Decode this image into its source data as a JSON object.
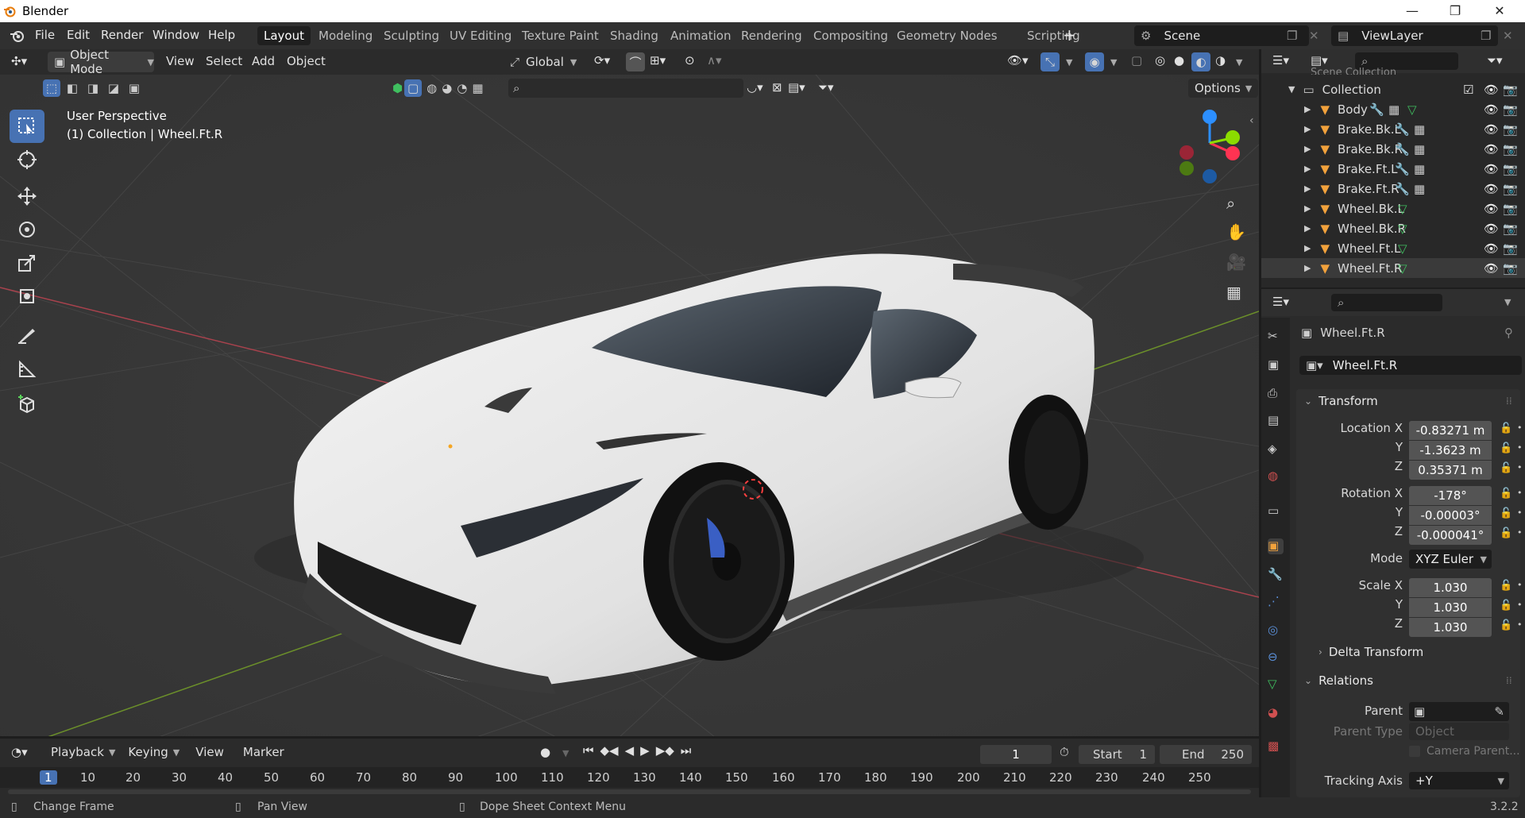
{
  "window": {
    "title": "Blender",
    "minimize": "—",
    "maximize": "❐",
    "close": "✕"
  },
  "menu": [
    "File",
    "Edit",
    "Render",
    "Window",
    "Help"
  ],
  "workspaces": [
    "Layout",
    "Modeling",
    "Sculpting",
    "UV Editing",
    "Texture Paint",
    "Shading",
    "Animation",
    "Rendering",
    "Compositing",
    "Geometry Nodes",
    "Scripting"
  ],
  "workspace_add": "+",
  "scene": "Scene",
  "view_layer": "ViewLayer",
  "viewport": {
    "mode": "Object Mode",
    "menus": [
      "View",
      "Select",
      "Add",
      "Object"
    ],
    "orientation": "Global",
    "options": "Options",
    "perspective": "User Perspective",
    "context": "(1) Collection | Wheel.Ft.R",
    "gizmo": {
      "x": "X",
      "y": "Y",
      "z": "Z"
    }
  },
  "outliner": {
    "root": "Scene Collection",
    "collection": "Collection",
    "items": [
      "Body",
      "Brake.Bk.L",
      "Brake.Bk.R",
      "Brake.Ft.L",
      "Brake.Ft.R",
      "Wheel.Bk.L",
      "Wheel.Bk.R",
      "Wheel.Ft.L",
      "Wheel.Ft.R"
    ],
    "selected": "Wheel.Ft.R"
  },
  "properties": {
    "object_name": "Wheel.Ft.R",
    "object_field": "Wheel.Ft.R",
    "transform_title": "Transform",
    "location_label": "Location X",
    "location": [
      "-0.83271 m",
      "-1.3623 m",
      "0.35371 m"
    ],
    "rotation_label": "Rotation X",
    "rotation": [
      "-178°",
      "-0.00003°",
      "-0.000041°"
    ],
    "axis_y": "Y",
    "axis_z": "Z",
    "mode_label": "Mode",
    "mode_value": "XYZ Euler",
    "scale_label": "Scale X",
    "scale": [
      "1.030",
      "1.030",
      "1.030"
    ],
    "delta_transform": "Delta Transform",
    "relations_title": "Relations",
    "parent_label": "Parent",
    "parent_type_label": "Parent Type",
    "parent_type_value": "Object",
    "camera_parent": "Camera Parent...",
    "tracking_axis_label": "Tracking Axis",
    "tracking_axis_value": "+Y"
  },
  "timeline": {
    "menus": [
      "Playback",
      "Keying",
      "View",
      "Marker"
    ],
    "current_frame": "1",
    "start_label": "Start",
    "start": "1",
    "end_label": "End",
    "end": "250",
    "ticks": [
      "1",
      "10",
      "20",
      "30",
      "40",
      "50",
      "60",
      "70",
      "80",
      "90",
      "100",
      "110",
      "120",
      "130",
      "140",
      "150",
      "160",
      "170",
      "180",
      "190",
      "200",
      "210",
      "220",
      "230",
      "240",
      "250"
    ]
  },
  "status": {
    "left": "Change Frame",
    "middle": "Pan View",
    "right": "Dope Sheet Context Menu",
    "version": "3.2.2"
  },
  "colors": {
    "accent": "#4772b3",
    "selection_orange": "#f5a623",
    "axis_x": "#ff3352",
    "axis_y": "#8bdc00",
    "axis_z": "#2c8fff",
    "car_body": "#e9e9e9"
  }
}
